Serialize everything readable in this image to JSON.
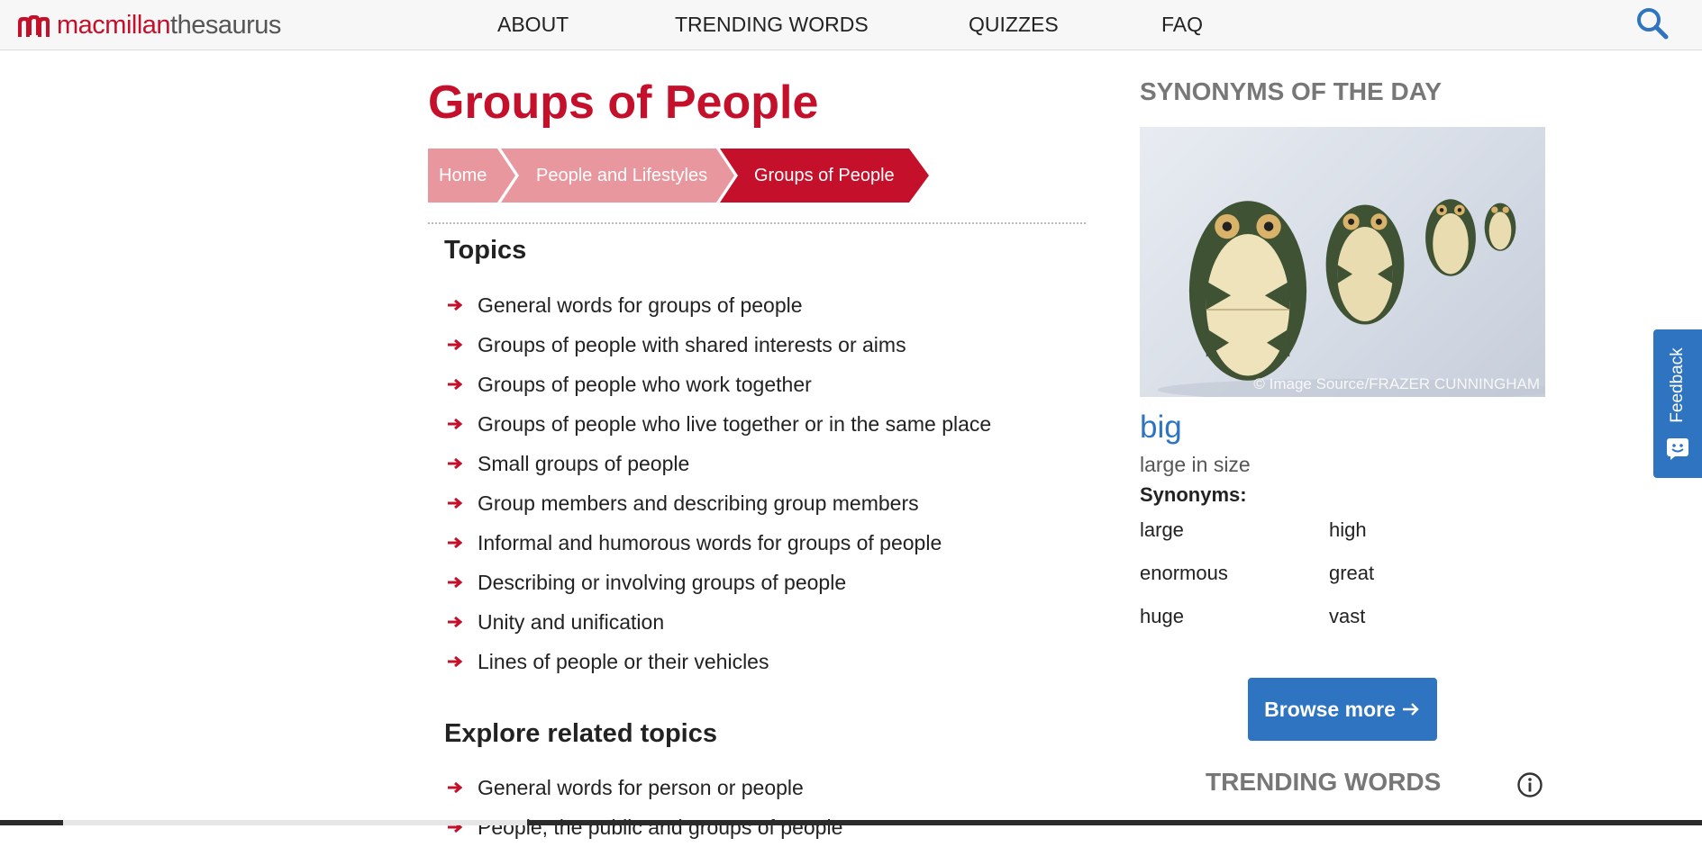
{
  "brand": {
    "word1": "macmillan",
    "word2": "thesaurus",
    "color": "#c4102a"
  },
  "nav": {
    "items": [
      {
        "label": "ABOUT"
      },
      {
        "label": "TRENDING WORDS"
      },
      {
        "label": "QUIZZES"
      },
      {
        "label": "FAQ"
      }
    ],
    "search_icon": "search-icon"
  },
  "page": {
    "title": "Groups of People",
    "breadcrumb": [
      {
        "label": "Home"
      },
      {
        "label": "People and Lifestyles"
      },
      {
        "label": "Groups of People"
      }
    ]
  },
  "topics": {
    "heading": "Topics",
    "items": [
      "General words for groups of people",
      "Groups of people with shared interests or aims",
      "Groups of people who work together",
      "Groups of people who live together or in the same place",
      "Small groups of people",
      "Group members and describing group members",
      "Informal and humorous words for groups of people",
      "Describing or involving groups of people",
      "Unity and unification",
      "Lines of people or their vehicles"
    ]
  },
  "related": {
    "heading": "Explore related topics",
    "items": [
      "General words for person or people",
      "People, the public and groups of people"
    ]
  },
  "synonyms_of_the_day": {
    "heading": "SYNONYMS OF THE DAY",
    "image_credit": "© Image Source/FRAZER CUNNINGHAM",
    "word": "big",
    "definition": "large in size",
    "synonyms_label": "Synonyms:",
    "synonyms": [
      "large",
      "high",
      "enormous",
      "great",
      "huge",
      "vast"
    ],
    "browse_label": "Browse more"
  },
  "trending": {
    "heading": "TRENDING WORDS"
  },
  "feedback": {
    "label": "Feedback"
  },
  "colors": {
    "accent_red": "#c4102a",
    "crumb_light": "#e8979f",
    "link_blue": "#2f74c0"
  }
}
